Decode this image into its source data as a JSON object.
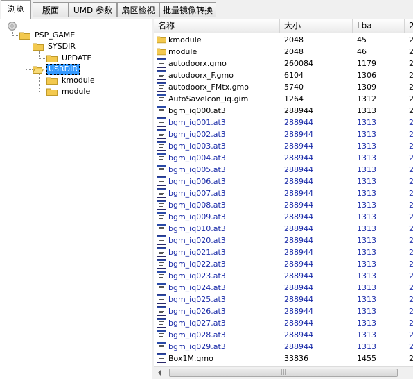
{
  "tabs": [
    {
      "label": "浏览",
      "active": true
    },
    {
      "label": "版面",
      "active": false
    },
    {
      "label": "UMD 参数",
      "active": false
    },
    {
      "label": "扇区检视",
      "active": false
    },
    {
      "label": "批量镜像转换",
      "active": false
    }
  ],
  "tree": {
    "root_icon": "disc-icon",
    "nodes": [
      {
        "label": "PSP_GAME",
        "selected": false
      },
      {
        "label": "SYSDIR",
        "selected": false
      },
      {
        "label": "UPDATE",
        "selected": false
      },
      {
        "label": "USRDIR",
        "selected": true
      },
      {
        "label": "kmodule",
        "selected": false
      },
      {
        "label": "module",
        "selected": false
      }
    ]
  },
  "list": {
    "columns": [
      "名称",
      "大小",
      "Lba",
      "2"
    ],
    "rows": [
      {
        "name": "kmodule",
        "size": "2048",
        "lba": "45",
        "extra": "2",
        "type": "folder",
        "blue": false
      },
      {
        "name": "module",
        "size": "2048",
        "lba": "46",
        "extra": "2",
        "type": "folder",
        "blue": false
      },
      {
        "name": "autodoorx.gmo",
        "size": "260084",
        "lba": "1179",
        "extra": "2",
        "type": "file",
        "blue": false
      },
      {
        "name": "autodoorx_F.gmo",
        "size": "6104",
        "lba": "1306",
        "extra": "2",
        "type": "file",
        "blue": false
      },
      {
        "name": "autodoorx_FMtx.gmo",
        "size": "5740",
        "lba": "1309",
        "extra": "2",
        "type": "file",
        "blue": false
      },
      {
        "name": "AutoSaveIcon_iq.gim",
        "size": "1264",
        "lba": "1312",
        "extra": "2",
        "type": "file",
        "blue": false
      },
      {
        "name": "bgm_iq000.at3",
        "size": "288944",
        "lba": "1313",
        "extra": "2",
        "type": "file",
        "blue": false
      },
      {
        "name": "bgm_iq001.at3",
        "size": "288944",
        "lba": "1313",
        "extra": "2",
        "type": "file",
        "blue": true
      },
      {
        "name": "bgm_iq002.at3",
        "size": "288944",
        "lba": "1313",
        "extra": "2",
        "type": "file",
        "blue": true
      },
      {
        "name": "bgm_iq003.at3",
        "size": "288944",
        "lba": "1313",
        "extra": "2",
        "type": "file",
        "blue": true
      },
      {
        "name": "bgm_iq004.at3",
        "size": "288944",
        "lba": "1313",
        "extra": "2",
        "type": "file",
        "blue": true
      },
      {
        "name": "bgm_iq005.at3",
        "size": "288944",
        "lba": "1313",
        "extra": "2",
        "type": "file",
        "blue": true
      },
      {
        "name": "bgm_iq006.at3",
        "size": "288944",
        "lba": "1313",
        "extra": "2",
        "type": "file",
        "blue": true
      },
      {
        "name": "bgm_iq007.at3",
        "size": "288944",
        "lba": "1313",
        "extra": "2",
        "type": "file",
        "blue": true
      },
      {
        "name": "bgm_iq008.at3",
        "size": "288944",
        "lba": "1313",
        "extra": "2",
        "type": "file",
        "blue": true
      },
      {
        "name": "bgm_iq009.at3",
        "size": "288944",
        "lba": "1313",
        "extra": "2",
        "type": "file",
        "blue": true
      },
      {
        "name": "bgm_iq010.at3",
        "size": "288944",
        "lba": "1313",
        "extra": "2",
        "type": "file",
        "blue": true
      },
      {
        "name": "bgm_iq020.at3",
        "size": "288944",
        "lba": "1313",
        "extra": "2",
        "type": "file",
        "blue": true
      },
      {
        "name": "bgm_iq021.at3",
        "size": "288944",
        "lba": "1313",
        "extra": "2",
        "type": "file",
        "blue": true
      },
      {
        "name": "bgm_iq022.at3",
        "size": "288944",
        "lba": "1313",
        "extra": "2",
        "type": "file",
        "blue": true
      },
      {
        "name": "bgm_iq023.at3",
        "size": "288944",
        "lba": "1313",
        "extra": "2",
        "type": "file",
        "blue": true
      },
      {
        "name": "bgm_iq024.at3",
        "size": "288944",
        "lba": "1313",
        "extra": "2",
        "type": "file",
        "blue": true
      },
      {
        "name": "bgm_iq025.at3",
        "size": "288944",
        "lba": "1313",
        "extra": "2",
        "type": "file",
        "blue": true
      },
      {
        "name": "bgm_iq026.at3",
        "size": "288944",
        "lba": "1313",
        "extra": "2",
        "type": "file",
        "blue": true
      },
      {
        "name": "bgm_iq027.at3",
        "size": "288944",
        "lba": "1313",
        "extra": "2",
        "type": "file",
        "blue": true
      },
      {
        "name": "bgm_iq028.at3",
        "size": "288944",
        "lba": "1313",
        "extra": "2",
        "type": "file",
        "blue": true
      },
      {
        "name": "bgm_iq029.at3",
        "size": "288944",
        "lba": "1313",
        "extra": "2",
        "type": "file",
        "blue": true
      },
      {
        "name": "Box1M.gmo",
        "size": "33836",
        "lba": "1455",
        "extra": "2",
        "type": "file",
        "blue": false
      }
    ]
  },
  "scrollbar": {
    "grip": "|||"
  },
  "colors": {
    "selection": "#3399ff",
    "shared_file_text": "#1a2ba8",
    "folder": "#f3c94f"
  }
}
